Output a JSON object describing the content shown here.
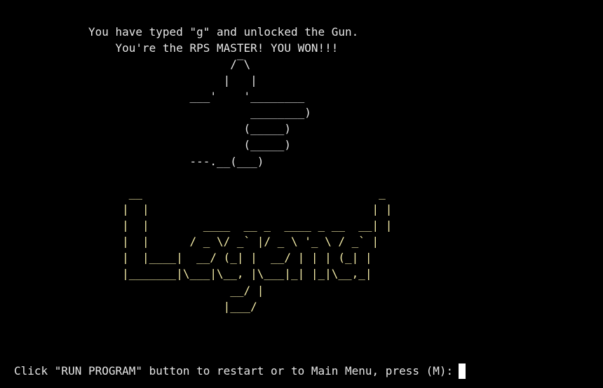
{
  "terminal": {
    "message_line_1": "           You have typed \"g\" and unlocked the Gun.",
    "message_line_2": "               You're the RPS MASTER! YOU WON!!!",
    "gun_art": "                                /‾\\\n                               |   |\n                          ___'    '________\n                                   ________)\n                                  (_____)\n                                  (_____)\n                          ---.__(___)",
    "legend_art": "                 __                                   _\n                |  |                                 | |\n                |  |        ____  __ _  ____ _ __  __| |\n                |  |      / _ \\/ _` |/ _ \\ '_ \\ / _` |\n                |  |____|  __/ (_| |  __/ | | | (_| |\n                |_______|\\___|\\__, |\\___|_| |_|\\__,_|\n                                __/ |\n                               |___/",
    "prompt_text": "Click \"RUN PROGRAM\" button to restart or to Main Menu, press (M):",
    "colors": {
      "background": "#000000",
      "text": "#e6e6e6",
      "legend": "#f2eaa6",
      "cursor": "#ffffff"
    }
  }
}
